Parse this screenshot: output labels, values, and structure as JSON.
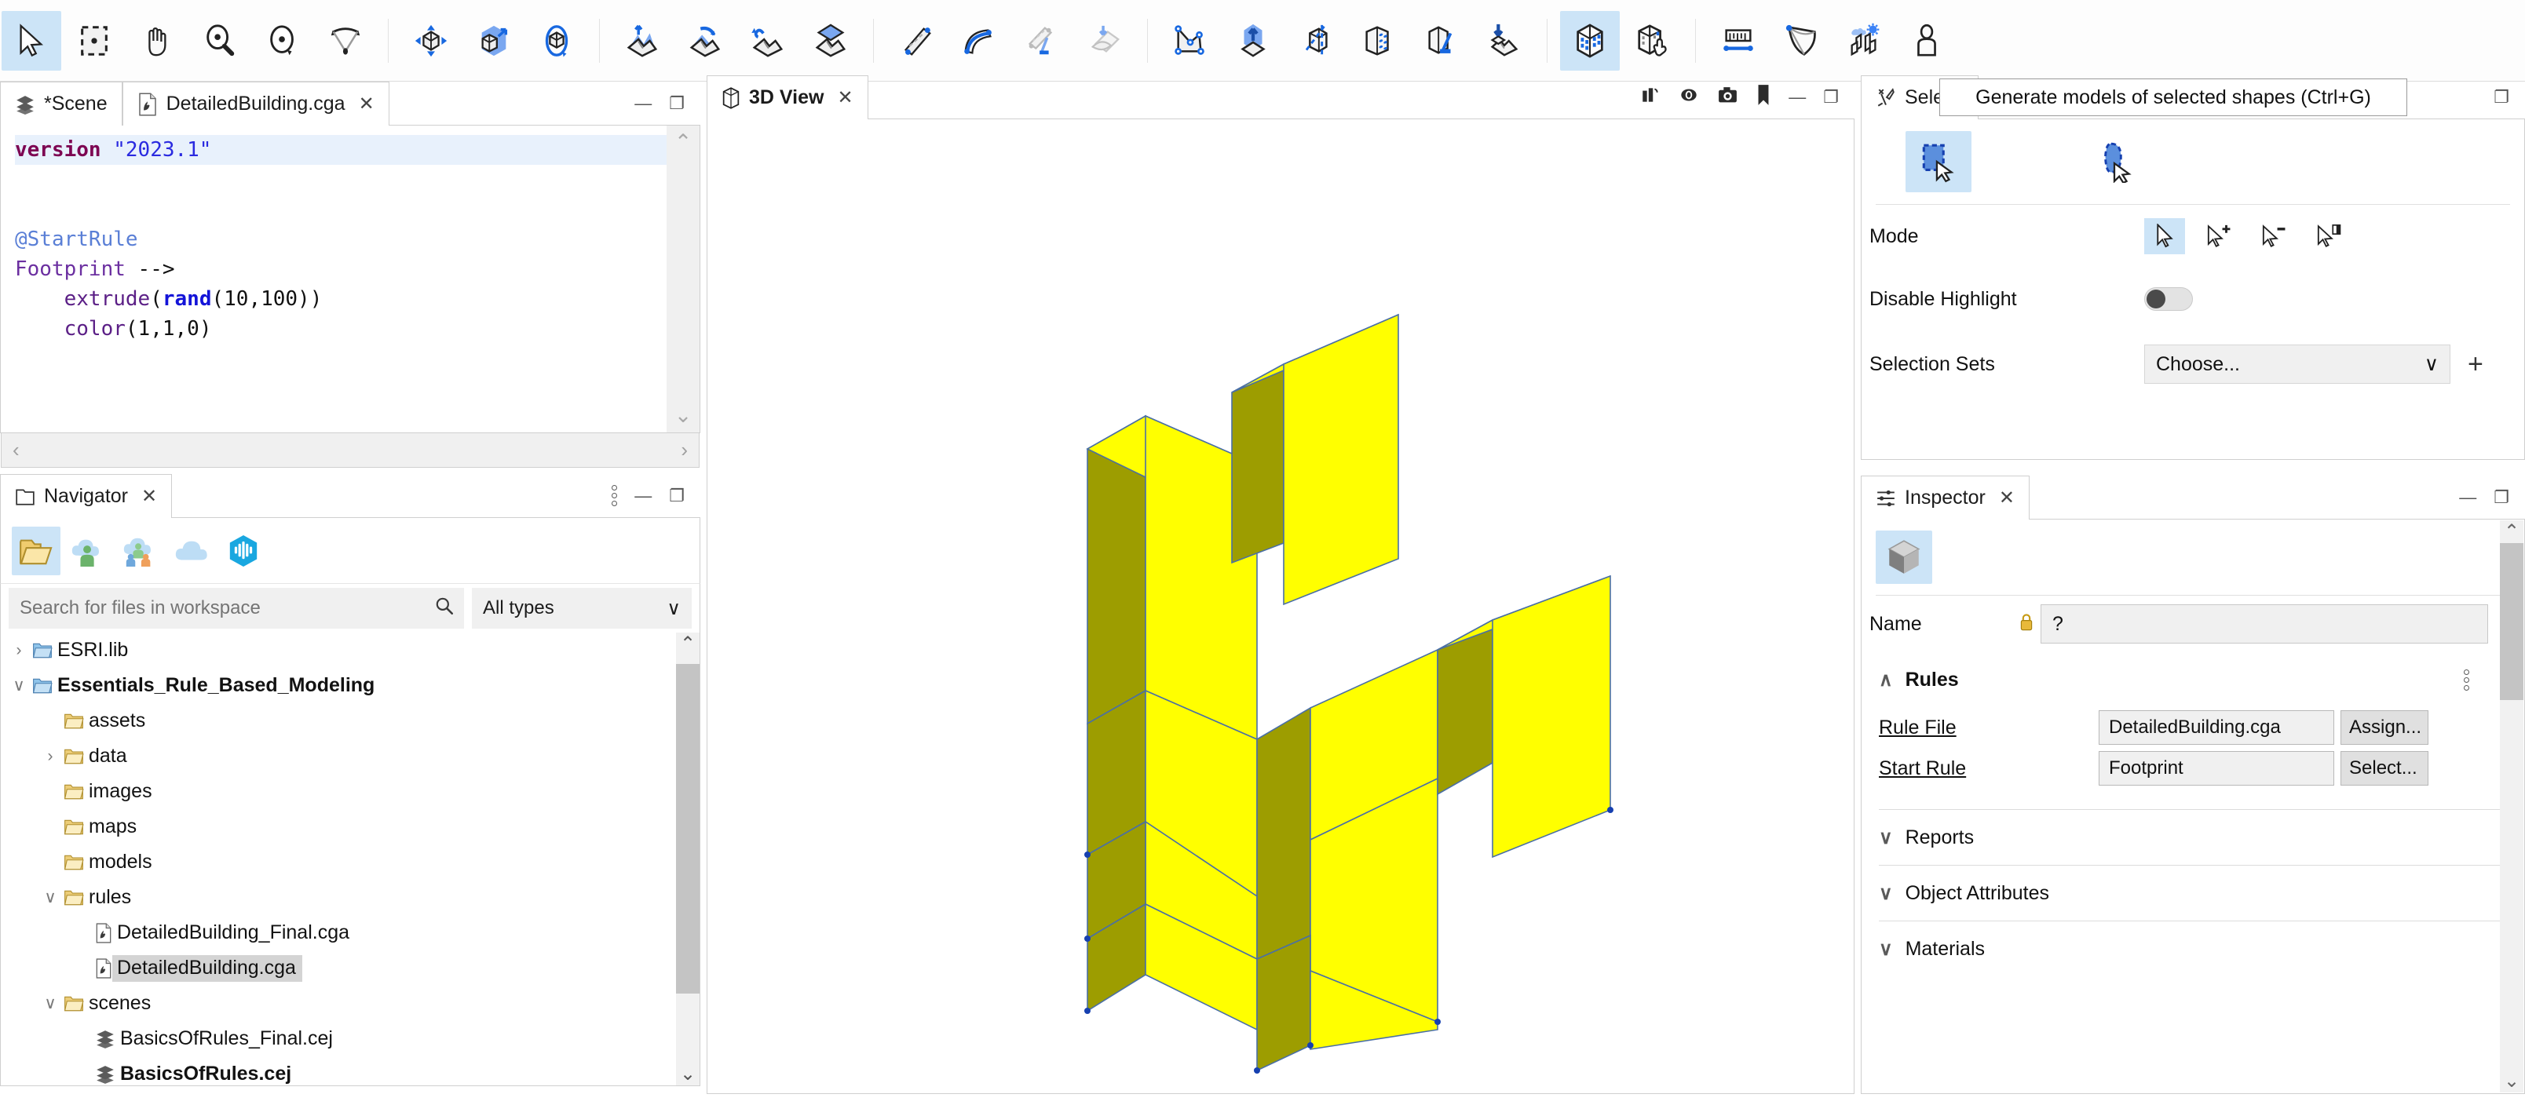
{
  "toolbar": {
    "groups": [
      {
        "buttons": [
          {
            "name": "select-tool",
            "label": "Select",
            "active": true
          },
          {
            "name": "marquee-select-tool",
            "label": "Rectangle Select",
            "active": false
          },
          {
            "name": "pan-tool",
            "label": "Pan",
            "active": false
          },
          {
            "name": "zoom-tool",
            "label": "Zoom",
            "active": false
          },
          {
            "name": "orbit-tool",
            "label": "Orbit",
            "active": false
          },
          {
            "name": "view-angle-tool",
            "label": "Field of View",
            "active": false
          }
        ]
      },
      {
        "buttons": [
          {
            "name": "move-tool",
            "label": "Move",
            "active": false
          },
          {
            "name": "scale-tool",
            "label": "Scale",
            "active": false
          },
          {
            "name": "rotate-tool",
            "label": "Rotate",
            "active": false
          }
        ]
      },
      {
        "buttons": [
          {
            "name": "push-pull-terrain-tool",
            "label": "Push/Pull Terrain",
            "active": false
          },
          {
            "name": "rotate-terrain-tool",
            "label": "Rotate Terrain",
            "active": false
          },
          {
            "name": "undo-terrain-tool",
            "label": "Reset Terrain",
            "active": false
          },
          {
            "name": "align-terrain-tool",
            "label": "Align Terrain",
            "active": false
          }
        ]
      },
      {
        "buttons": [
          {
            "name": "straight-street-tool",
            "label": "Street Creation",
            "active": false
          },
          {
            "name": "curved-street-tool",
            "label": "Curved Street",
            "active": false
          },
          {
            "name": "street-cleanup-tool",
            "label": "Cleanup Streets",
            "active": false
          },
          {
            "name": "graph-snap-tool",
            "label": "Snap Graph",
            "active": false
          }
        ]
      },
      {
        "buttons": [
          {
            "name": "polygonal-shape-tool",
            "label": "Polygonal Shape Creation",
            "active": false
          },
          {
            "name": "push-pull-tool",
            "label": "Push Pull",
            "active": false
          },
          {
            "name": "split-shape-tool",
            "label": "Split Shape",
            "active": false
          },
          {
            "name": "texture-shape-tool",
            "label": "Texture Shape",
            "active": false
          },
          {
            "name": "cleanup-shapes-tool",
            "label": "Cleanup Shapes",
            "active": false
          },
          {
            "name": "align-shapes-tool",
            "label": "Align Shapes to Terrain",
            "active": false
          }
        ]
      },
      {
        "buttons": [
          {
            "name": "generate-models-tool",
            "label": "Generate models of selected shapes",
            "active": true
          },
          {
            "name": "select-models-tool",
            "label": "Select Models",
            "active": false
          }
        ]
      },
      {
        "buttons": [
          {
            "name": "measure-tool",
            "label": "Measure",
            "active": false
          },
          {
            "name": "viewshed-tool",
            "label": "Viewshed",
            "active": false
          },
          {
            "name": "shadow-analysis-tool",
            "label": "Shadow Analysis",
            "active": false
          },
          {
            "name": "person-scale-tool",
            "label": "Human Scale Figure",
            "active": false
          }
        ]
      }
    ],
    "tooltip": "Generate models of selected shapes (Ctrl+G)"
  },
  "editor": {
    "tabs": [
      {
        "label": "*Scene",
        "icon": "layers-icon",
        "active": false,
        "closable": false
      },
      {
        "label": "DetailedBuilding.cga",
        "icon": "cga-file-icon",
        "active": true,
        "closable": true
      }
    ],
    "window_buttons": {
      "minimize": "—",
      "maximize": "❐"
    },
    "code": {
      "lines": [
        {
          "segments": [
            {
              "t": "version",
              "c": "k-version"
            },
            {
              "t": " ",
              "c": "k-op"
            },
            {
              "t": "\"2023.1\"",
              "c": "k-str"
            }
          ],
          "highlight": true
        },
        {
          "segments": [],
          "highlight": false
        },
        {
          "segments": [
            {
              "t": "@StartRule",
              "c": "k-annot"
            }
          ],
          "highlight": false
        },
        {
          "segments": [
            {
              "t": "Footprint",
              "c": "k-rule"
            },
            {
              "t": " -->",
              "c": "k-op"
            }
          ],
          "highlight": false
        },
        {
          "segments": [
            {
              "t": "    ",
              "c": "k-op"
            },
            {
              "t": "extrude",
              "c": "k-func"
            },
            {
              "t": "(",
              "c": "k-op"
            },
            {
              "t": "rand",
              "c": "k-builtin"
            },
            {
              "t": "(10,100))",
              "c": "k-op"
            }
          ],
          "highlight": false
        },
        {
          "segments": [
            {
              "t": "    ",
              "c": "k-op"
            },
            {
              "t": "color",
              "c": "k-func"
            },
            {
              "t": "(1,1,0)",
              "c": "k-op"
            }
          ],
          "highlight": false
        }
      ]
    },
    "scroll_up": "⌃",
    "scroll_down": "⌄",
    "scroll_left": "‹",
    "scroll_right": "›"
  },
  "navigator": {
    "title": "Navigator",
    "close": "✕",
    "toolbar_icons": [
      {
        "name": "workspace-folder-icon",
        "active": true
      },
      {
        "name": "my-content-cloud-icon",
        "active": false
      },
      {
        "name": "shared-content-cloud-icon",
        "active": false
      },
      {
        "name": "cloud-icon",
        "active": false
      },
      {
        "name": "living-atlas-icon",
        "active": false
      }
    ],
    "search": {
      "placeholder": "Search for files in workspace",
      "value": "",
      "icon": "search-icon"
    },
    "type_filter": {
      "value": "All types",
      "chevron": "∨"
    },
    "tree": [
      {
        "label": "ESRI.lib",
        "indent": 1,
        "twisty": "›",
        "icon": "folder-blue-icon",
        "bold": false,
        "selected": false
      },
      {
        "label": "Essentials_Rule_Based_Modeling",
        "indent": 1,
        "twisty": "∨",
        "icon": "folder-blue-icon",
        "bold": true,
        "selected": false
      },
      {
        "label": "assets",
        "indent": 2,
        "twisty": "",
        "icon": "folder-icon",
        "bold": false,
        "selected": false
      },
      {
        "label": "data",
        "indent": 2,
        "twisty": "›",
        "icon": "folder-icon",
        "bold": false,
        "selected": false
      },
      {
        "label": "images",
        "indent": 2,
        "twisty": "",
        "icon": "folder-icon",
        "bold": false,
        "selected": false
      },
      {
        "label": "maps",
        "indent": 2,
        "twisty": "",
        "icon": "folder-icon",
        "bold": false,
        "selected": false
      },
      {
        "label": "models",
        "indent": 2,
        "twisty": "",
        "icon": "folder-icon",
        "bold": false,
        "selected": false
      },
      {
        "label": "rules",
        "indent": 2,
        "twisty": "∨",
        "icon": "folder-icon",
        "bold": false,
        "selected": false
      },
      {
        "label": "DetailedBuilding_Final.cga",
        "indent": 3,
        "twisty": "",
        "icon": "cga-file-icon",
        "bold": false,
        "selected": false
      },
      {
        "label": "DetailedBuilding.cga",
        "indent": 3,
        "twisty": "",
        "icon": "cga-file-icon",
        "bold": false,
        "selected": true
      },
      {
        "label": "scenes",
        "indent": 2,
        "twisty": "∨",
        "icon": "folder-icon",
        "bold": false,
        "selected": false
      },
      {
        "label": "BasicsOfRules_Final.cej",
        "indent": 3,
        "twisty": "",
        "icon": "scene-icon",
        "bold": false,
        "selected": false
      },
      {
        "label": "BasicsOfRules.cej",
        "indent": 3,
        "twisty": "",
        "icon": "scene-icon",
        "bold": true,
        "selected": false
      }
    ],
    "scroll_up": "⌃",
    "scroll_down": "⌄"
  },
  "view3d": {
    "title": "3D View",
    "close": "✕",
    "icon": "cube-outline-icon",
    "header_icons": [
      {
        "name": "layers-panel-icon"
      },
      {
        "name": "eye-icon"
      },
      {
        "name": "camera-icon"
      },
      {
        "name": "bookmark-icon"
      }
    ],
    "window_buttons": {
      "minimize": "—",
      "maximize": "❐"
    },
    "model": {
      "name": "extruded-building-model",
      "color": "#ffff00",
      "shade_color": "#999900",
      "edge_color": "#4a6fa5"
    }
  },
  "selection": {
    "title": "Selecti",
    "full_title": "Selection",
    "icon": "tools-icon",
    "window_buttons": {
      "maximize": "❐"
    },
    "tool_icons": [
      {
        "name": "rectangle-selection-icon",
        "active": true
      },
      {
        "name": "lasso-selection-icon",
        "active": false
      }
    ],
    "mode": {
      "label": "Mode",
      "options": [
        {
          "name": "cursor-replace-icon",
          "active": true
        },
        {
          "name": "cursor-add-icon",
          "active": false
        },
        {
          "name": "cursor-subtract-icon",
          "active": false
        },
        {
          "name": "cursor-intersect-icon",
          "active": false
        }
      ]
    },
    "disable_highlight": {
      "label": "Disable Highlight",
      "value": false
    },
    "selection_sets": {
      "label": "Selection Sets",
      "value": "Choose...",
      "chevron": "∨",
      "add": "+"
    }
  },
  "inspector": {
    "title": "Inspector",
    "close": "✕",
    "icon": "sliders-icon",
    "window_buttons": {
      "minimize": "—",
      "maximize": "❐"
    },
    "tool_icon": {
      "name": "shape-inspect-icon",
      "active": true
    },
    "name_row": {
      "label": "Name",
      "value": "?",
      "warning_icon": "lock-warning-icon"
    },
    "sections": [
      {
        "label": "Rules",
        "expanded": true,
        "chevron": "∧",
        "bold": true,
        "menu": "dots-menu-icon"
      },
      {
        "label": "Reports",
        "expanded": false,
        "chevron": "∨",
        "bold": false
      },
      {
        "label": "Object Attributes",
        "expanded": false,
        "chevron": "∨",
        "bold": false
      },
      {
        "label": "Materials",
        "expanded": false,
        "chevron": "∨",
        "bold": false
      }
    ],
    "rules": {
      "rule_file": {
        "label": "Rule File",
        "value": "DetailedBuilding.cga",
        "button": "Assign..."
      },
      "start_rule": {
        "label": "Start Rule",
        "value": "Footprint",
        "button": "Select..."
      }
    },
    "scroll_up": "⌃",
    "scroll_down": "⌄"
  }
}
